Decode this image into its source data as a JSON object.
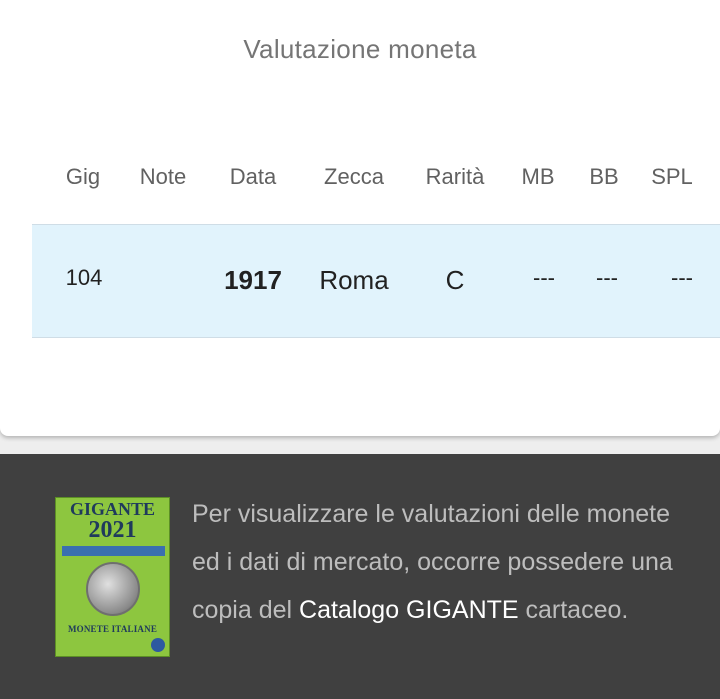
{
  "card": {
    "title": "Valutazione moneta"
  },
  "table": {
    "headers": [
      "Gig",
      "Note",
      "Data",
      "Zecca",
      "Rarità",
      "MB",
      "BB",
      "SPL"
    ],
    "rows": [
      {
        "gig": "104",
        "note": "",
        "data": "1917",
        "zecca": "Roma",
        "rarita": "C",
        "mb": "---",
        "bb": "---",
        "spl": "---"
      }
    ],
    "row_highlight_color": "#e1f3fc"
  },
  "banner": {
    "text_before": "Per visualizzare le valutazioni delle monete ed i dati di mercato, occorre possedere una copia del ",
    "text_highlight": "Catalogo GIGANTE",
    "text_after": " cartaceo.",
    "background_color": "#404040",
    "book": {
      "title": "GIGANTE",
      "year": "2021",
      "subtitle": "MONETE ITALIANE"
    }
  }
}
